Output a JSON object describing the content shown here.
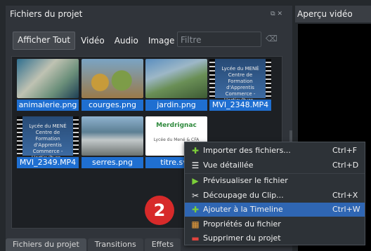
{
  "files_panel": {
    "title": "Fichiers du projet",
    "filters": [
      "Afficher Tout",
      "Vidéo",
      "Audio",
      "Image"
    ],
    "filter_placeholder": "Filtre"
  },
  "files": [
    {
      "name": "animalerie.png"
    },
    {
      "name": "courges.png"
    },
    {
      "name": "jardin.png"
    },
    {
      "name": "MVI_2348.MP4",
      "thumb_text": "Lycée du MENÉ\nCentre de Formation d'Apprentis\nCommerce - Horticulture - Paysage"
    },
    {
      "name": "MVI_2349.MP4",
      "thumb_text": "Lycée du MENÉ\nCentre de Formation d'Apprentis\nCommerce - Horticulture - Paysage"
    },
    {
      "name": "serres.png"
    },
    {
      "name": "titre.svg",
      "thumb_title": "Merdrignac",
      "thumb_sub": "Lycée du Mené & CFA"
    }
  ],
  "preview": {
    "title": "Aperçu vidéo"
  },
  "bottom_tabs": [
    "Fichiers du projet",
    "Transitions",
    "Effets"
  ],
  "context_menu": {
    "items": [
      {
        "label": "Importer des fichiers...",
        "shortcut": "Ctrl+F",
        "icon": "plus-icon"
      },
      {
        "label": "Vue détaillée",
        "shortcut": "Ctrl+D",
        "icon": "list-view-icon"
      },
      {
        "label": "Prévisualiser le fichier",
        "shortcut": "",
        "icon": "play-icon"
      },
      {
        "label": "Découpage du Clip...",
        "shortcut": "Ctrl+X",
        "icon": "scissors-icon"
      },
      {
        "label": "Ajouter à la Timeline",
        "shortcut": "Ctrl+W",
        "icon": "plus-icon",
        "highlighted": true
      },
      {
        "label": "Propriétés du fichier",
        "shortcut": "",
        "icon": "properties-icon"
      },
      {
        "label": "Supprimer du projet",
        "shortcut": "",
        "icon": "minus-icon"
      }
    ]
  },
  "callout": {
    "number": "2"
  },
  "colors": {
    "accent": "#1f6fd1",
    "badge": "#d72a2a"
  }
}
